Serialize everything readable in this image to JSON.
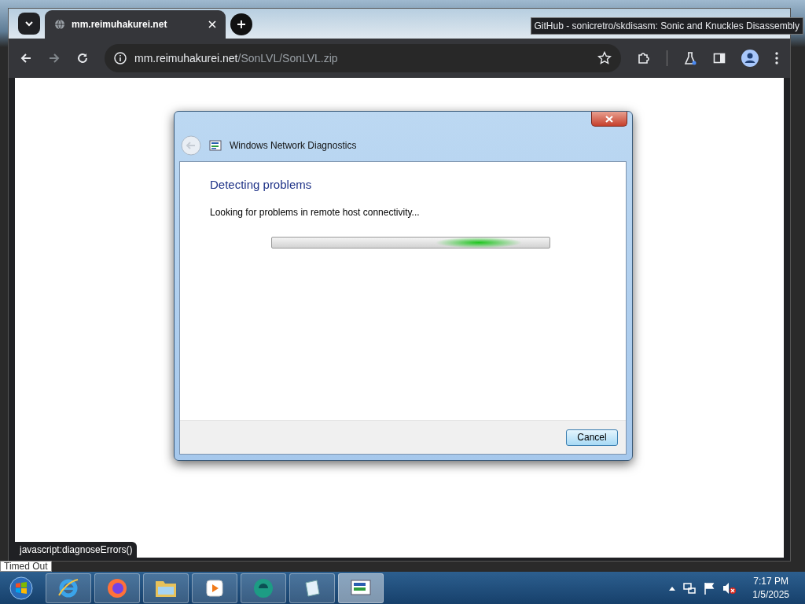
{
  "browser": {
    "tab": {
      "title": "mm.reimuhakurei.net",
      "selected": true
    },
    "tooltip": "GitHub - sonicretro/skdisasm: Sonic and Knuckles Disassembly",
    "address": {
      "host": "mm.reimuhakurei.net",
      "path": "/SonLVL/SonLVL.zip"
    },
    "status_link": "javascript:diagnoseErrors()"
  },
  "dialog": {
    "title": "Windows Network Diagnostics",
    "heading": "Detecting problems",
    "message": "Looking for problems in remote host connectivity...",
    "progress": {
      "level": 0.9
    },
    "buttons": [
      "Cancel"
    ]
  },
  "taskbar_tooltip": "Timed Out",
  "taskbar": {
    "time": "7:17 PM",
    "date": "1/5/2025"
  }
}
